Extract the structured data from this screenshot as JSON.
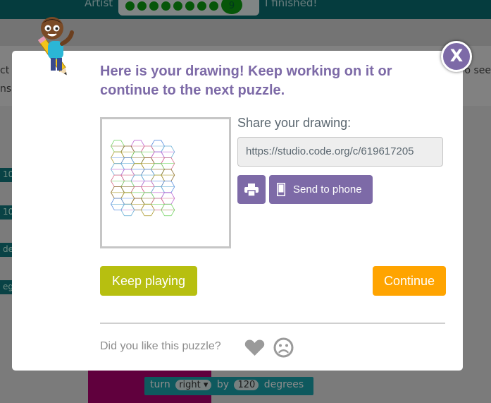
{
  "background": {
    "artist_label": "Artist",
    "level_number": "9",
    "finished_label": "I finished!",
    "code_turn": "turn",
    "code_direction": "right ▾",
    "code_by": "by",
    "code_degrees_value": "120",
    "code_degrees": "degrees",
    "side_blocks": [
      "10",
      "10",
      "de",
      "eg"
    ],
    "left_text_1": "ct",
    "left_text_2": "ns",
    "right_text": "o see"
  },
  "dialog": {
    "headline": "Here is your drawing! Keep working on it or continue to the next puzzle.",
    "share_label": "Share your drawing:",
    "share_url": "https://studio.code.org/c/619617205",
    "print_icon": "printer-icon",
    "send_to_phone_label": "Send to phone",
    "phone_icon": "mobile-phone-icon",
    "keep_playing_label": "Keep playing",
    "continue_label": "Continue",
    "feedback_question": "Did you like this puzzle?",
    "close_label": "X"
  },
  "colors": {
    "accent_purple": "#7d6aa7",
    "keep_green": "#b7bf10",
    "continue_orange": "#ffa400",
    "header_teal": "#0a6d72"
  }
}
